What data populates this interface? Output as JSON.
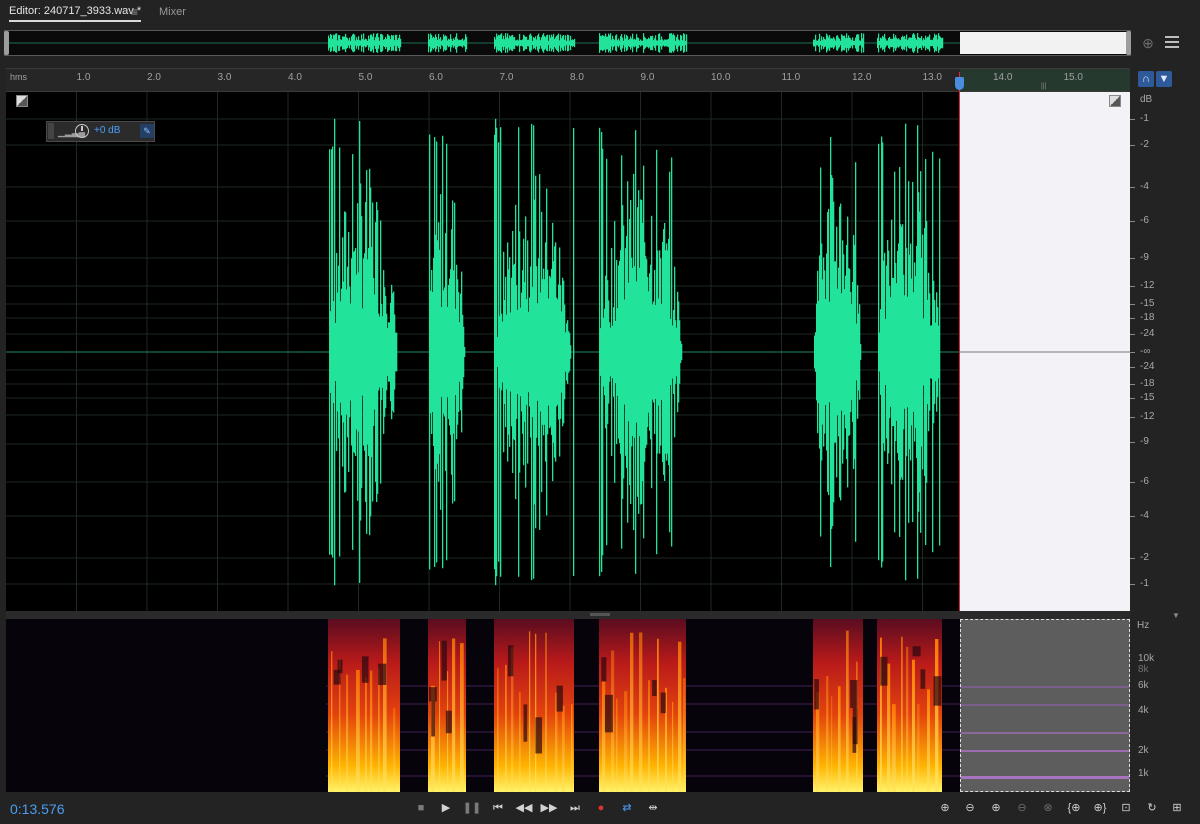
{
  "tabs": {
    "editor_label": "Editor: 240717_3933.wav *",
    "menu_icon": "hamburger-icon",
    "mixer_label": "Mixer"
  },
  "ruler": {
    "unit": "hms",
    "ticks": [
      "1.0",
      "2.0",
      "3.0",
      "4.0",
      "5.0",
      "6.0",
      "7.0",
      "8.0",
      "9.0",
      "10.0",
      "11.0",
      "12.0",
      "13.0",
      "14.0",
      "15.0"
    ]
  },
  "hud": {
    "volume_value": "+0 dB"
  },
  "db_scale": {
    "title": "dB",
    "labels": [
      "-1",
      "-2",
      "-4",
      "-6",
      "-9",
      "-12",
      "-15",
      "-18",
      "-24",
      "-∞",
      "-24",
      "-18",
      "-15",
      "-12",
      "-9",
      "-6",
      "-4",
      "-2",
      "-1"
    ]
  },
  "hz_scale": {
    "title": "Hz",
    "labels": [
      {
        "text": "10k",
        "dim": false
      },
      {
        "text": "8k",
        "dim": true
      },
      {
        "text": "6k",
        "dim": false
      },
      {
        "text": "4k",
        "dim": false
      },
      {
        "text": "2k",
        "dim": false
      },
      {
        "text": "1k",
        "dim": false
      }
    ]
  },
  "transport": {
    "time": "0:13.576",
    "buttons": [
      "stop",
      "play",
      "pause",
      "go-to-start",
      "rewind",
      "fast-forward",
      "go-to-end",
      "record",
      "loop",
      "skip-selection"
    ]
  },
  "colors": {
    "waveform": "#22e39a",
    "playhead": "#e0243a",
    "accent": "#4a9ef0",
    "selection_bg": "#f3f3f7"
  }
}
